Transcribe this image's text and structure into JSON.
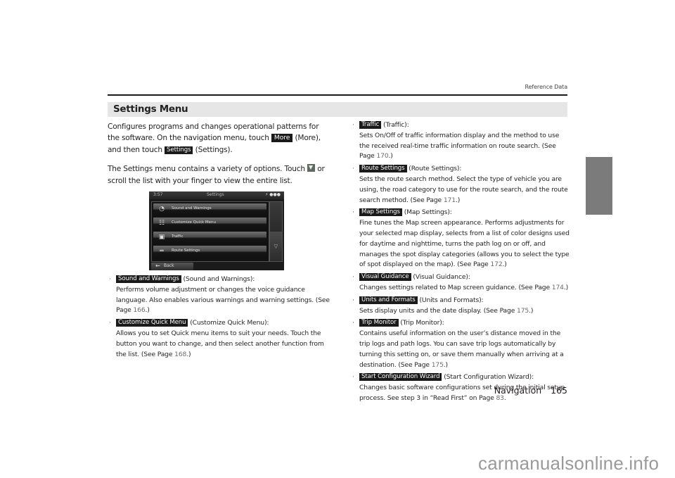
{
  "header": {
    "section_ref": "Reference Data"
  },
  "section": {
    "title": "Settings Menu"
  },
  "intro": {
    "p1_a": "Configures programs and changes operational patterns for the software. On the navigation menu, touch ",
    "p1_tag1": "More",
    "p1_b": " (More), and then touch ",
    "p1_tag2": "Settings",
    "p1_c": " (Settings).",
    "p2_a": "The Settings menu contains a variety of options. Touch ",
    "p2_icon": "scroll-down-icon",
    "p2_b": " or scroll the list with your finger to view the entire list."
  },
  "device_screen": {
    "time": "3:57",
    "title": "Settings",
    "status_icons": "⚡ ●●●",
    "items": [
      {
        "icon": "speaker-icon",
        "glyph": "◔",
        "label": "Sound and Warnings"
      },
      {
        "icon": "quick-menu-icon",
        "glyph": "☷",
        "label": "Customize Quick Menu"
      },
      {
        "icon": "traffic-icon",
        "glyph": "▣",
        "label": "Traffic"
      },
      {
        "icon": "route-icon",
        "glyph": "═",
        "label": "Route Settings"
      }
    ],
    "scroll_down_glyph": "▽",
    "back_label": "Back",
    "back_arrow": "←"
  },
  "items_left": [
    {
      "tag": "Sound and Warnings",
      "name": " (Sound and Warnings):",
      "desc": "Performs volume adjustment or changes the voice guidance language. Also enables various warnings and warning settings. (See Page ",
      "page": "166",
      "end": ".)"
    },
    {
      "tag": "Customize Quick Menu",
      "name": " (Customize Quick Menu):",
      "desc": "Allows you to set Quick menu items to suit your needs. Touch the button you want to change, and then select another function from the list. (See Page ",
      "page": "168",
      "end": ".)"
    }
  ],
  "items_right": [
    {
      "tag": "Traffic",
      "name": " (Traffic):",
      "desc": "Sets On/Off of traffic information display and the method to use the received real-time traffic information on route search. (See Page ",
      "page": "170",
      "end": ".)"
    },
    {
      "tag": "Route Settings",
      "name": " (Route Settings):",
      "desc": "Sets the route search method. Select the type of vehicle you are using, the road category to use for the route search, and the route search method. (See Page ",
      "page": "171",
      "end": ".)"
    },
    {
      "tag": "Map Settings",
      "name": " (Map Settings):",
      "desc": "Fine tunes the Map screen appearance. Performs adjustments for your selected map display, selects from a list of color designs used for daytime and nighttime, turns the path log on or off, and manages the spot display categories (allows you to select the type of spot displayed on the map). (See Page ",
      "page": "172",
      "end": ".)"
    },
    {
      "tag": "Visual Guidance",
      "name": " (Visual Guidance):",
      "desc": "Changes settings related to Map screen guidance. (See Page ",
      "page": "174",
      "end": ".)"
    },
    {
      "tag": "Units and Formats",
      "name": " (Units and Formats):",
      "desc": "Sets display units and the date display. (See Page ",
      "page": "175",
      "end": ".)"
    },
    {
      "tag": "Trip Monitor",
      "name": " (Trip Monitor):",
      "desc": "Contains useful information on the user’s distance moved in the trip logs and path logs. You can save trip logs automatically by turning this setting on, or save them manually when arriving at a destination. (See Page ",
      "page": "175",
      "end": ".)"
    },
    {
      "tag": "Start Configuration Wizard",
      "name": " (Start Configuration Wizard):",
      "desc": "Changes basic software configurations set during the initial setup process. See step 3 in “Read First” on Page ",
      "page": "83",
      "end": "."
    }
  ],
  "bullet": "·",
  "footer": {
    "section": "Navigation",
    "page": "165"
  },
  "watermark": "carmanualsonline.info",
  "colors": {
    "tag_bg": "#1a1a1a",
    "section_bar": "#e6e6e6",
    "side_tab": "#7b7b7b",
    "page_link": "#6b6b6b"
  }
}
